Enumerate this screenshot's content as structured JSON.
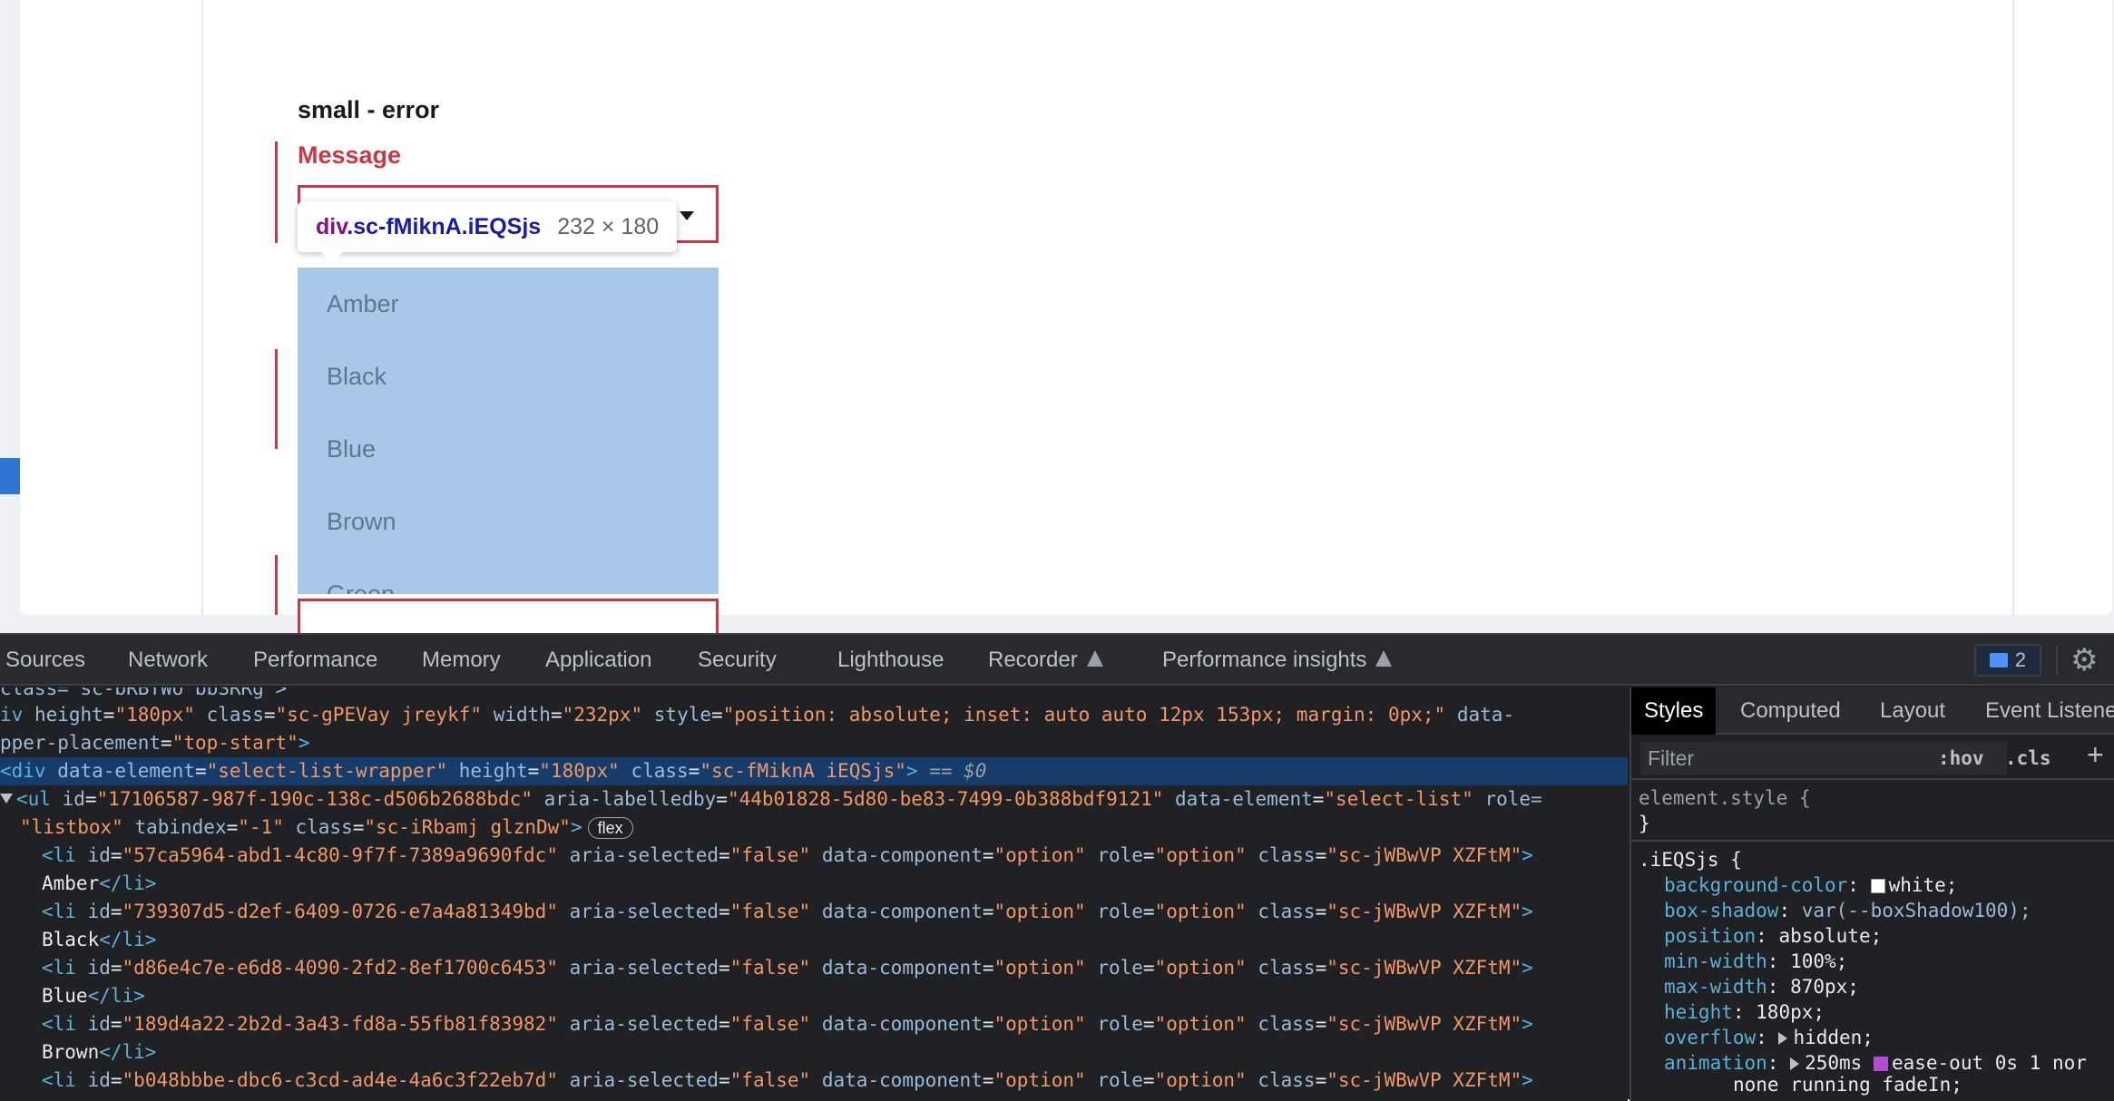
{
  "page": {
    "section_title": "small - error",
    "field_label": "Message",
    "inspector_tooltip": {
      "tag": "div",
      "class": ".sc-fMiknA.iEQSjs",
      "size": "232 × 180"
    },
    "options": [
      "Amber",
      "Black",
      "Blue",
      "Brown",
      "Green"
    ]
  },
  "devtools": {
    "tabs": [
      "Sources",
      "Network",
      "Performance",
      "Memory",
      "Application",
      "Security",
      "Lighthouse",
      "Recorder",
      "Performance insights"
    ],
    "issues_count": "2",
    "elements": {
      "line0": "class=\"sc-bRBYWo bbSRRg\">",
      "line1": {
        "prefix": "iv ",
        "a1": "height",
        "v1": "\"180px\"",
        "a2": "class",
        "v2": "\"sc-gPEVay jreykf\"",
        "a3": "width",
        "v3": "\"232px\"",
        "a4": "style",
        "v4": "\"position: absolute; inset: auto auto 12px 153px; margin: 0px;\"",
        "a5": "data-"
      },
      "line2": {
        "a1": "pper-placement",
        "v1": "\"top-start\"",
        "end": ">"
      },
      "line3": {
        "open": "<div ",
        "a1": "data-element",
        "v1": "\"select-list-wrapper\"",
        "a2": "height",
        "v2": "\"180px\"",
        "a3": "class",
        "v3": "\"sc-fMiknA iEQSjs\"",
        "end": ">",
        "marker": " == $0"
      },
      "line4": {
        "open": "<ul ",
        "a1": "id",
        "v1": "\"17106587-987f-190c-138c-d506b2688bdc\"",
        "a2": "aria-labelledby",
        "v2": "\"44b01828-5d80-be83-7499-0b388bdf9121\"",
        "a3": "data-element",
        "v3": "\"select-list\"",
        "a4": "role="
      },
      "line5": {
        "v0": "\"listbox\"",
        "a1": "tabindex",
        "v1": "\"-1\"",
        "a2": "class",
        "v2": "\"sc-iRbamj glznDw\"",
        "end": ">",
        "badge": "flex"
      },
      "li_items": [
        {
          "id": "\"57ca5964-abd1-4c80-9f7f-7389a9690fdc\"",
          "text": "Amber"
        },
        {
          "id": "\"739307d5-d2ef-6409-0726-e7a4a81349bd\"",
          "text": "Black"
        },
        {
          "id": "\"d86e4c7e-e6d8-4090-2fd2-8ef1700c6453\"",
          "text": "Blue"
        },
        {
          "id": "\"189d4a22-2b2d-3a43-fd8a-55fb81f83982\"",
          "text": "Brown"
        },
        {
          "id": "\"b048bbbe-dbc6-c3cd-ad4e-4a6c3f22eb7d\"",
          "text": ""
        }
      ],
      "li_attrs": {
        "open": "<li ",
        "a_id": "id",
        "a1": "aria-selected",
        "v1": "\"false\"",
        "a2": "data-component",
        "v2": "\"option\"",
        "a3": "role",
        "v3": "\"option\"",
        "a4": "class",
        "v4": "\"sc-jWBwVP XZFtM\"",
        "end": ">",
        "close": "</li>"
      }
    },
    "styles": {
      "tabs": [
        "Styles",
        "Computed",
        "Layout",
        "Event Listene"
      ],
      "filter_placeholder": "Filter",
      "hov": ":hov",
      "cls": ".cls",
      "element_style": "element.style {",
      "close_brace": "}",
      "rule_selector": ".iEQSjs {",
      "props": [
        {
          "name": "background-color",
          "value": "white;"
        },
        {
          "name": "box-shadow",
          "value": "var(--boxShadow100);"
        },
        {
          "name": "position",
          "value": "absolute;"
        },
        {
          "name": "min-width",
          "value": "100%;"
        },
        {
          "name": "max-width",
          "value": "870px;"
        },
        {
          "name": "height",
          "value": "180px;"
        },
        {
          "name": "overflow",
          "value": "hidden;"
        },
        {
          "name": "animation",
          "value": "250ms"
        }
      ],
      "animation_rest": "ease-out 0s 1 nor",
      "animation_line2": "none running fadeIn;"
    }
  },
  "colors": {
    "error": "#c83845",
    "highlight": "#a8c7e9",
    "selected_row": "#163c6b"
  }
}
